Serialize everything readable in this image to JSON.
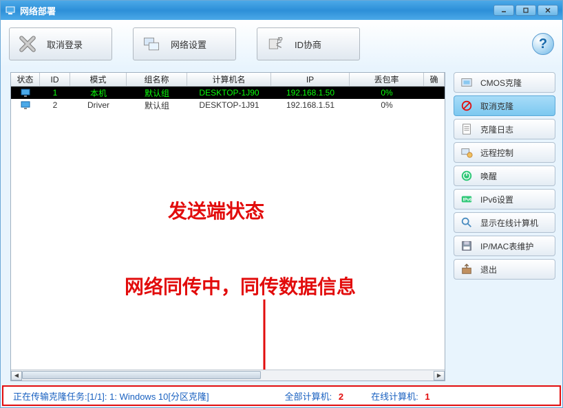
{
  "window": {
    "title": "网络部署"
  },
  "toolbar": {
    "cancel_login": "取消登录",
    "network_settings": "网络设置",
    "id_negotiation": "ID协商"
  },
  "table": {
    "headers": {
      "status": "状态",
      "id": "ID",
      "mode": "模式",
      "group": "组名称",
      "computer": "计算机名",
      "ip": "IP",
      "packet": "丢包率",
      "last": "确"
    },
    "rows": [
      {
        "id": "1",
        "mode": "本机",
        "group": "默认组",
        "computer": "DESKTOP-1J90",
        "ip": "192.168.1.50",
        "packet": "0%",
        "selected": true
      },
      {
        "id": "2",
        "mode": "Driver",
        "group": "默认组",
        "computer": "DESKTOP-1J91",
        "ip": "192.168.1.51",
        "packet": "0%",
        "selected": false
      }
    ]
  },
  "side": {
    "cmos_clone": "CMOS克隆",
    "cancel_clone": "取消克隆",
    "clone_log": "克隆日志",
    "remote_control": "远程控制",
    "wake": "唤醒",
    "ipv6_settings": "IPv6设置",
    "show_online": "显示在线计算机",
    "ip_mac": "IP/MAC表维护",
    "exit": "退出"
  },
  "annotations": {
    "sender_state": "发送端状态",
    "sync_info": "网络同传中，同传数据信息"
  },
  "status": {
    "task": "正在传输克隆任务:[1/1]: 1: Windows 10[分区克隆]",
    "total_label": "全部计算机:",
    "total_value": "2",
    "online_label": "在线计算机:",
    "online_value": "1"
  }
}
